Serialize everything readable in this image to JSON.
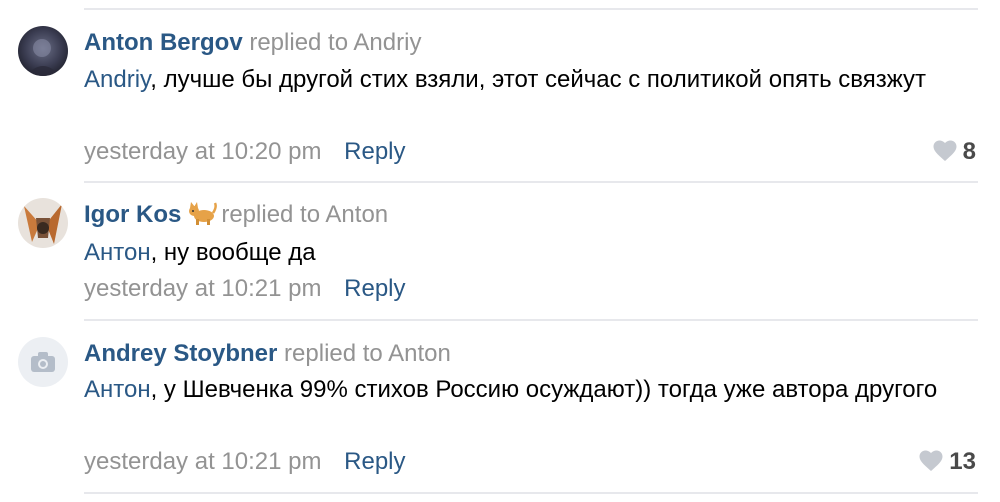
{
  "comments": [
    {
      "author": "Anton Bergov",
      "replied_to": "replied to Andriy",
      "mention": "Andriy",
      "text": ", лучше бы другой стих взяли, этот сейчас с политикой опять связжут",
      "time": "yesterday at 10:20 pm",
      "reply_label": "Reply",
      "likes": "8",
      "avatar": "user-photo"
    },
    {
      "author": "Igor Kos",
      "author_emoji": "cat-emoji",
      "replied_to": "replied to Anton",
      "mention": "Антон",
      "text": ", ну вообще да",
      "time": "yesterday at 10:21 pm",
      "reply_label": "Reply",
      "avatar": "user-photo"
    },
    {
      "author": "Andrey Stoybner",
      "replied_to": "replied to Anton",
      "mention": "Антон",
      "text": ", у Шевченка 99% стихов Россию осуждают)) тогда уже автора другого",
      "time": "yesterday at 10:21 pm",
      "reply_label": "Reply",
      "likes": "13",
      "avatar": "camera-placeholder"
    }
  ],
  "colors": {
    "link": "#2a5885",
    "muted": "#939393",
    "divider": "#e7e8ec",
    "heart": "#c5c9d0"
  }
}
